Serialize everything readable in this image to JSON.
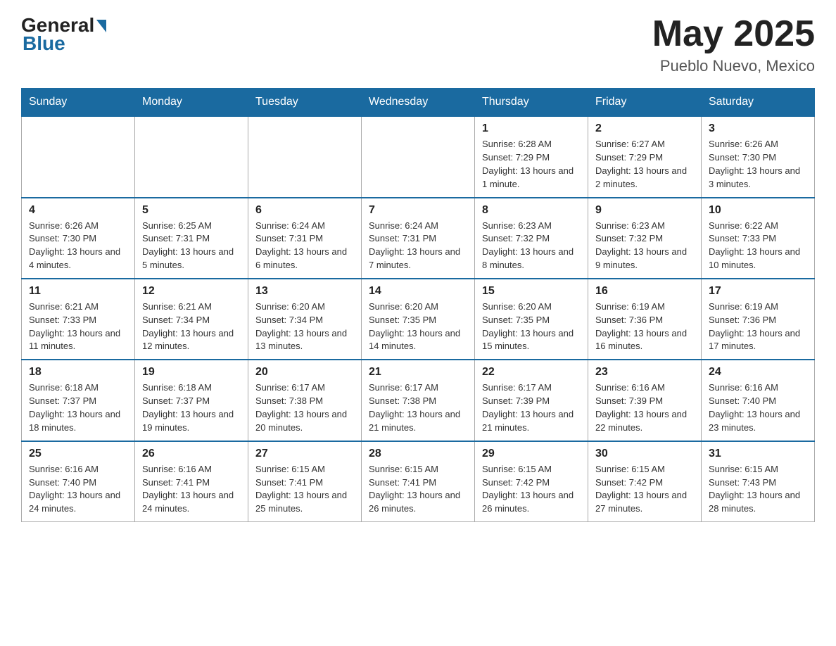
{
  "header": {
    "logo_text_1": "General",
    "logo_text_2": "Blue",
    "month_title": "May 2025",
    "location": "Pueblo Nuevo, Mexico"
  },
  "columns": [
    "Sunday",
    "Monday",
    "Tuesday",
    "Wednesday",
    "Thursday",
    "Friday",
    "Saturday"
  ],
  "weeks": [
    [
      {
        "day": "",
        "info": ""
      },
      {
        "day": "",
        "info": ""
      },
      {
        "day": "",
        "info": ""
      },
      {
        "day": "",
        "info": ""
      },
      {
        "day": "1",
        "info": "Sunrise: 6:28 AM\nSunset: 7:29 PM\nDaylight: 13 hours and 1 minute."
      },
      {
        "day": "2",
        "info": "Sunrise: 6:27 AM\nSunset: 7:29 PM\nDaylight: 13 hours and 2 minutes."
      },
      {
        "day": "3",
        "info": "Sunrise: 6:26 AM\nSunset: 7:30 PM\nDaylight: 13 hours and 3 minutes."
      }
    ],
    [
      {
        "day": "4",
        "info": "Sunrise: 6:26 AM\nSunset: 7:30 PM\nDaylight: 13 hours and 4 minutes."
      },
      {
        "day": "5",
        "info": "Sunrise: 6:25 AM\nSunset: 7:31 PM\nDaylight: 13 hours and 5 minutes."
      },
      {
        "day": "6",
        "info": "Sunrise: 6:24 AM\nSunset: 7:31 PM\nDaylight: 13 hours and 6 minutes."
      },
      {
        "day": "7",
        "info": "Sunrise: 6:24 AM\nSunset: 7:31 PM\nDaylight: 13 hours and 7 minutes."
      },
      {
        "day": "8",
        "info": "Sunrise: 6:23 AM\nSunset: 7:32 PM\nDaylight: 13 hours and 8 minutes."
      },
      {
        "day": "9",
        "info": "Sunrise: 6:23 AM\nSunset: 7:32 PM\nDaylight: 13 hours and 9 minutes."
      },
      {
        "day": "10",
        "info": "Sunrise: 6:22 AM\nSunset: 7:33 PM\nDaylight: 13 hours and 10 minutes."
      }
    ],
    [
      {
        "day": "11",
        "info": "Sunrise: 6:21 AM\nSunset: 7:33 PM\nDaylight: 13 hours and 11 minutes."
      },
      {
        "day": "12",
        "info": "Sunrise: 6:21 AM\nSunset: 7:34 PM\nDaylight: 13 hours and 12 minutes."
      },
      {
        "day": "13",
        "info": "Sunrise: 6:20 AM\nSunset: 7:34 PM\nDaylight: 13 hours and 13 minutes."
      },
      {
        "day": "14",
        "info": "Sunrise: 6:20 AM\nSunset: 7:35 PM\nDaylight: 13 hours and 14 minutes."
      },
      {
        "day": "15",
        "info": "Sunrise: 6:20 AM\nSunset: 7:35 PM\nDaylight: 13 hours and 15 minutes."
      },
      {
        "day": "16",
        "info": "Sunrise: 6:19 AM\nSunset: 7:36 PM\nDaylight: 13 hours and 16 minutes."
      },
      {
        "day": "17",
        "info": "Sunrise: 6:19 AM\nSunset: 7:36 PM\nDaylight: 13 hours and 17 minutes."
      }
    ],
    [
      {
        "day": "18",
        "info": "Sunrise: 6:18 AM\nSunset: 7:37 PM\nDaylight: 13 hours and 18 minutes."
      },
      {
        "day": "19",
        "info": "Sunrise: 6:18 AM\nSunset: 7:37 PM\nDaylight: 13 hours and 19 minutes."
      },
      {
        "day": "20",
        "info": "Sunrise: 6:17 AM\nSunset: 7:38 PM\nDaylight: 13 hours and 20 minutes."
      },
      {
        "day": "21",
        "info": "Sunrise: 6:17 AM\nSunset: 7:38 PM\nDaylight: 13 hours and 21 minutes."
      },
      {
        "day": "22",
        "info": "Sunrise: 6:17 AM\nSunset: 7:39 PM\nDaylight: 13 hours and 21 minutes."
      },
      {
        "day": "23",
        "info": "Sunrise: 6:16 AM\nSunset: 7:39 PM\nDaylight: 13 hours and 22 minutes."
      },
      {
        "day": "24",
        "info": "Sunrise: 6:16 AM\nSunset: 7:40 PM\nDaylight: 13 hours and 23 minutes."
      }
    ],
    [
      {
        "day": "25",
        "info": "Sunrise: 6:16 AM\nSunset: 7:40 PM\nDaylight: 13 hours and 24 minutes."
      },
      {
        "day": "26",
        "info": "Sunrise: 6:16 AM\nSunset: 7:41 PM\nDaylight: 13 hours and 24 minutes."
      },
      {
        "day": "27",
        "info": "Sunrise: 6:15 AM\nSunset: 7:41 PM\nDaylight: 13 hours and 25 minutes."
      },
      {
        "day": "28",
        "info": "Sunrise: 6:15 AM\nSunset: 7:41 PM\nDaylight: 13 hours and 26 minutes."
      },
      {
        "day": "29",
        "info": "Sunrise: 6:15 AM\nSunset: 7:42 PM\nDaylight: 13 hours and 26 minutes."
      },
      {
        "day": "30",
        "info": "Sunrise: 6:15 AM\nSunset: 7:42 PM\nDaylight: 13 hours and 27 minutes."
      },
      {
        "day": "31",
        "info": "Sunrise: 6:15 AM\nSunset: 7:43 PM\nDaylight: 13 hours and 28 minutes."
      }
    ]
  ]
}
